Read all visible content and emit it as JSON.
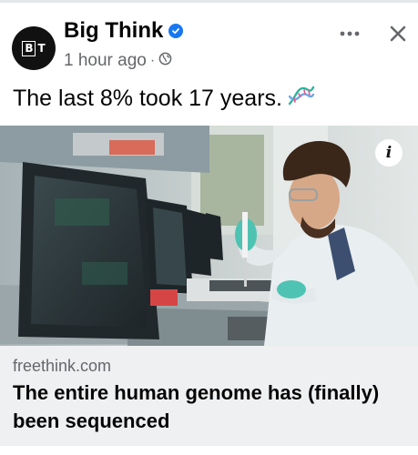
{
  "post": {
    "page_name": "Big Think",
    "avatar_logo": "BT",
    "verified_icon": "verified-badge-icon",
    "timestamp": "1 hour ago",
    "audience_icon": "globe-icon",
    "caption": "The last 8% took 17 years.",
    "caption_emoji": "dna-icon",
    "menu_icon": "more-dots-icon",
    "close_icon": "close-icon"
  },
  "image": {
    "subject": "scientist-pipetting-in-lab-photo",
    "info_glyph": "i"
  },
  "link": {
    "domain": "freethink.com",
    "headline": "The entire human genome has (finally) been sequenced"
  },
  "colors": {
    "brand_blue": "#1877f2",
    "secondary_text": "#65676b",
    "card_bg": "#eff0f2",
    "avatar_bg": "#111111"
  }
}
